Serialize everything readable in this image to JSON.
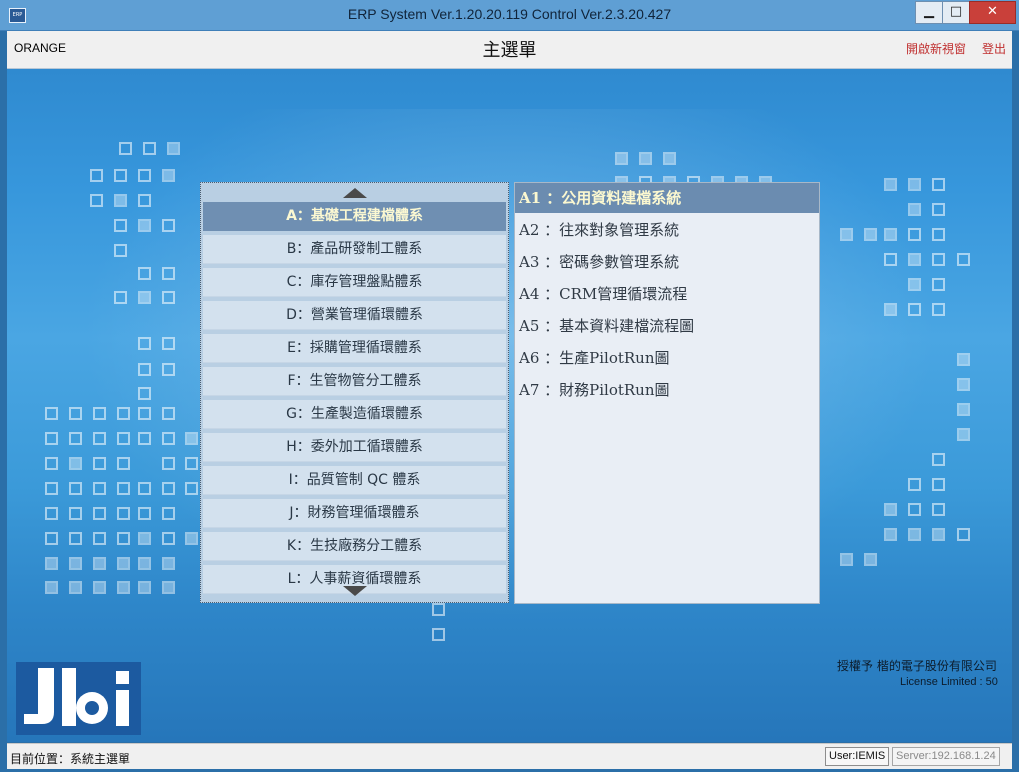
{
  "window": {
    "title": "ERP System Ver.1.20.20.119  Control Ver.2.3.20.427",
    "icon_label": "ERP",
    "buttons": {
      "minimize": "▁",
      "maximize": "□",
      "close": "✕"
    }
  },
  "header": {
    "company": "ORANGE",
    "title": "主選單",
    "open_new_window": "開啟新視窗",
    "logout": "登出"
  },
  "categories": [
    {
      "label": "A：基礎工程建檔體系",
      "active": true
    },
    {
      "label": "B：產品研發制工體系"
    },
    {
      "label": "C：庫存管理盤點體系"
    },
    {
      "label": "D：營業管理循環體系"
    },
    {
      "label": "E：採購管理循環體系"
    },
    {
      "label": "F：生管物管分工體系"
    },
    {
      "label": "G：生產製造循環體系"
    },
    {
      "label": "H：委外加工循環體系"
    },
    {
      "label": "I：品質管制 QC 體系"
    },
    {
      "label": "J：財務管理循環體系"
    },
    {
      "label": "K：生技廠務分工體系"
    },
    {
      "label": "L：人事薪資循環體系"
    }
  ],
  "subitems": [
    {
      "label": "A1 ：公用資料建檔系統",
      "active": true
    },
    {
      "label": "A2 ：往來對象管理系統"
    },
    {
      "label": "A3 ：密碼參數管理系統"
    },
    {
      "label": "A4 ：CRM管理循環流程"
    },
    {
      "label": "A5 ：基本資料建檔流程圖"
    },
    {
      "label": "A6 ：生產PilotRun圖"
    },
    {
      "label": "A7 ：財務PilotRun圖"
    }
  ],
  "license": {
    "authorized": "授權予 楷的電子股份有限公司",
    "limit": "License Limited  : 50"
  },
  "status": {
    "location": "目前位置：系統主選單",
    "user": "User:IEMIS",
    "server": "Server:192.168.1.24"
  },
  "colors": {
    "active_item_bg": "#6f8fb2",
    "active_item_text": "#fbf8d2",
    "link": "#c03030",
    "background_blue": "#3797dc"
  }
}
